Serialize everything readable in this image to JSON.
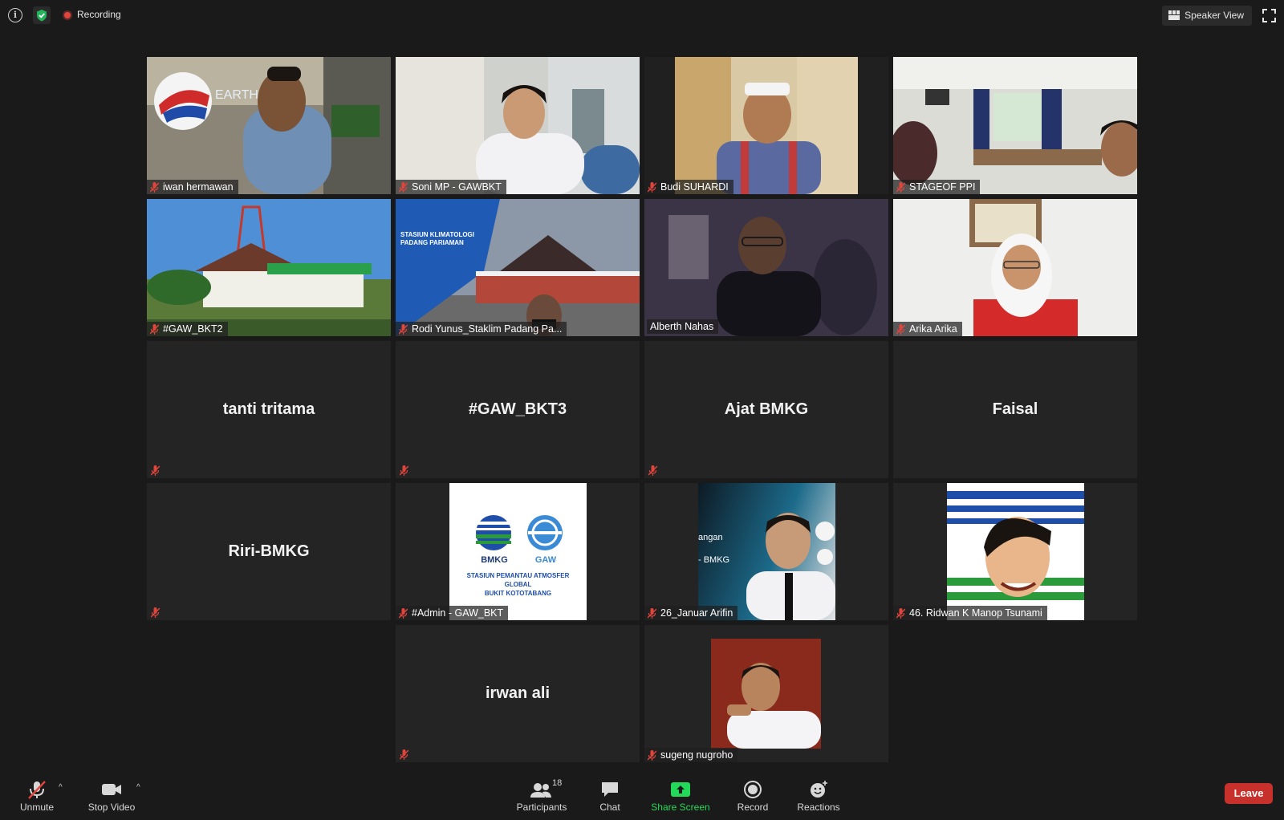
{
  "topbar": {
    "recording_label": "Recording",
    "speaker_view_label": "Speaker View"
  },
  "participants": [
    {
      "name": "iwan hermawan",
      "mode": "video"
    },
    {
      "name": "Soni MP - GAWBKT",
      "mode": "video"
    },
    {
      "name": "Budi SUHARDI",
      "mode": "video"
    },
    {
      "name": "STAGEOF PPI",
      "mode": "video"
    },
    {
      "name": "#GAW_BKT2",
      "mode": "video"
    },
    {
      "name": "Rodi Yunus_Staklim Padang Pa...",
      "mode": "video"
    },
    {
      "name": "Alberth Nahas",
      "mode": "video",
      "active_speaker": true
    },
    {
      "name": "Arika Arika",
      "mode": "video"
    },
    {
      "name": "tanti tritama",
      "mode": "name"
    },
    {
      "name": "#GAW_BKT3",
      "mode": "name"
    },
    {
      "name": "Ajat BMKG",
      "mode": "name"
    },
    {
      "name": "Faisal",
      "mode": "name"
    },
    {
      "name": "Riri-BMKG",
      "mode": "name"
    },
    {
      "name": "#Admin - GAW_BKT",
      "mode": "avatar"
    },
    {
      "name": "26_Januar Arifin",
      "mode": "avatar"
    },
    {
      "name": "46. Ridwan K Manop Tsunami",
      "mode": "avatar"
    },
    {
      "name": "irwan ali",
      "mode": "name"
    },
    {
      "name": "sugeng nugroho",
      "mode": "avatar"
    }
  ],
  "admin_logo": {
    "left": "BMKG",
    "right": "GAW",
    "caption_line1": "STASIUN PEMANTAU ATMOSFER GLOBAL",
    "caption_line2": "BUKIT KOTOTABANG"
  },
  "januar_slide": {
    "line1": "angan",
    "line2": "- BMKG"
  },
  "rodi_slide": {
    "line1": "STASIUN KLIMATOLOGI",
    "line2": "PADANG PARIAMAN"
  },
  "toolbar": {
    "unmute_label": "Unmute",
    "stop_video_label": "Stop Video",
    "participants_label": "Participants",
    "participants_count": "18",
    "chat_label": "Chat",
    "share_screen_label": "Share Screen",
    "record_label": "Record",
    "reactions_label": "Reactions",
    "leave_label": "Leave"
  },
  "colors": {
    "active_border": "#d8d86a",
    "share_green": "#23d959",
    "leave_red": "#c8312b",
    "mute_red": "#e0453c"
  }
}
